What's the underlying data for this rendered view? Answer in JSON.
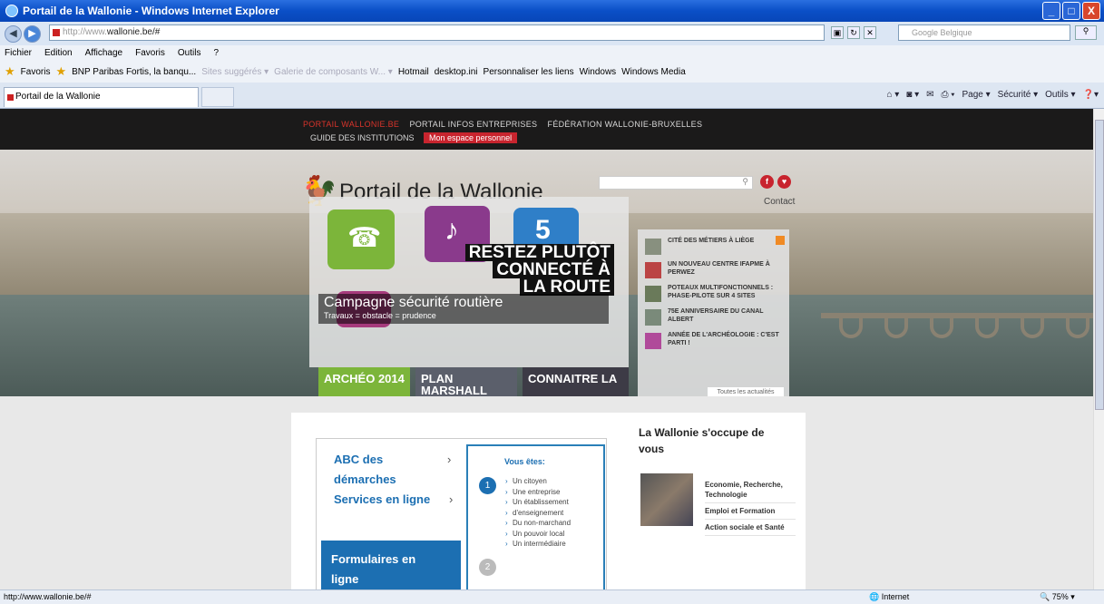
{
  "window": {
    "title": "Portail de la Wallonie - Windows Internet Explorer",
    "min": "_",
    "max": "□",
    "close": "X"
  },
  "address": {
    "url_gray": "http://www.",
    "url_dark": "wallonie.be/#",
    "search_placeholder": "Google Belgique"
  },
  "menu": [
    "Fichier",
    "Edition",
    "Affichage",
    "Favoris",
    "Outils",
    "?"
  ],
  "favorites": {
    "label": "Favoris",
    "items": [
      "BNP Paribas Fortis, la banqu...",
      "Sites suggérés ▾",
      "Galerie de composants W... ▾",
      "Hotmail",
      "desktop.ini",
      "Personnaliser les liens",
      "Windows",
      "Windows Media"
    ]
  },
  "tab": {
    "label": "Portail de la Wallonie"
  },
  "commandbar": [
    "Page ▾",
    "Sécurité ▾",
    "Outils ▾"
  ],
  "site": {
    "topnav": {
      "portal": "PORTAIL WALLONIE.BE",
      "link2": "PORTAIL INFOS ENTREPRISES",
      "link3": "FÉDÉRATION WALLONIE-BRUXELLES",
      "link4": "GUIDE DES INSTITUTIONS",
      "space": "Mon espace personnel"
    },
    "logo_text": "Portail de la Wallonie",
    "contact": "Contact",
    "social": [
      "f",
      "♥"
    ],
    "slider": {
      "slogan": [
        "RESTEZ PLUTÔT",
        "CONNECTÉ À",
        "LA ROUTE"
      ],
      "caption_title": "Campagne sécurité routière",
      "caption_sub": "Travaux = obstacle = prudence"
    },
    "feature_tabs": [
      "ARCHÉO 2014",
      "PLAN MARSHALL",
      "CONNAITRE LA"
    ],
    "news": [
      "CITÉ DES MÉTIERS À LIÈGE",
      "UN NOUVEAU CENTRE IFAPME À PERWEZ",
      "POTEAUX MULTIFONCTIONNELS : PHASE-PILOTE SUR 4 SITES",
      "75E ANNIVERSAIRE DU CANAL ALBERT",
      "ANNÉE DE L'ARCHÉOLOGIE : C'EST PARTI !"
    ],
    "all_news": "Toutes les actualités",
    "abc": {
      "line1": "ABC des",
      "line2": "démarches",
      "services": "Services en ligne",
      "form1": "Formulaires en",
      "form2": "ligne"
    },
    "vous": {
      "title": "Vous êtes:",
      "items": [
        "Un citoyen",
        "Une entreprise",
        "Un établissement",
        "d'enseignement",
        "Du non-marchand",
        "Un pouvoir local",
        "Un intermédiaire"
      ],
      "step1": "1",
      "step2": "2"
    },
    "occupe": {
      "title1": "La Wallonie s'occupe de",
      "title2": "vous",
      "links": [
        "Economie, Recherche, Technologie",
        "Emploi et Formation",
        "Action sociale et Santé"
      ]
    }
  },
  "status": {
    "url": "http://www.wallonie.be/#",
    "zone": "Internet",
    "zoom": "75%"
  }
}
